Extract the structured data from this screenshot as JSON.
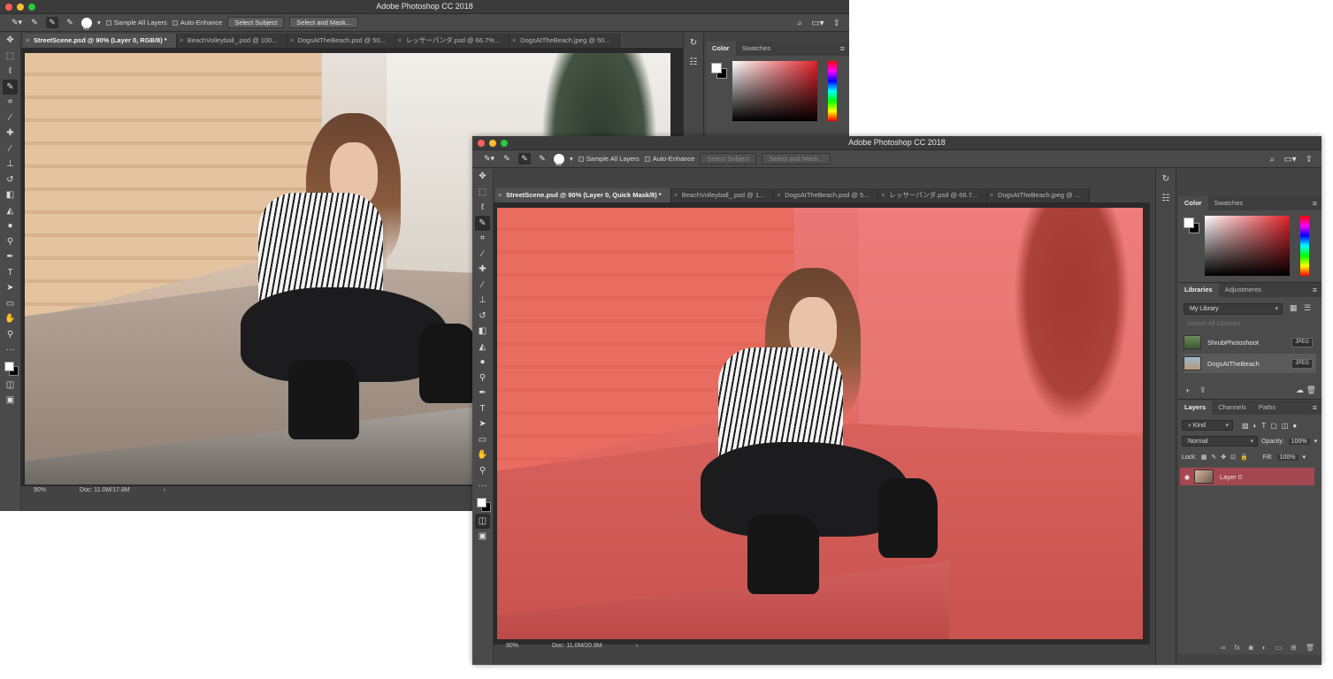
{
  "back_window": {
    "title": "Adobe Photoshop CC 2018",
    "options": {
      "brush_size": "45",
      "sample_all_layers": "Sample All Layers",
      "auto_enhance": "Auto-Enhance",
      "select_subject": "Select Subject",
      "select_and_mask": "Select and Mask..."
    },
    "tabs": [
      "StreetScene.psd @ 90% (Layer 0, RGB/8) *",
      "BeachVolleyball_.psd @ 100...",
      "DogsAtTheBeach.psd @ 50...",
      "レッサーパンダ.psd @ 66.7%...",
      "DogsAtTheBeach.jpeg @ 50..."
    ],
    "status": {
      "zoom": "90%",
      "doc": "Doc: 11.0M/17.8M",
      "arrow": "›"
    },
    "color_panel": {
      "tabs": [
        "Color",
        "Swatches"
      ]
    }
  },
  "front_window": {
    "title": "Adobe Photoshop CC 2018",
    "options": {
      "brush_size": "45",
      "sample_all_layers": "Sample All Layers",
      "auto_enhance": "Auto-Enhance",
      "select_subject": "Select Subject",
      "select_and_mask": "Select and Mask..."
    },
    "tabs": [
      "StreetScene.psd @ 90% (Layer 0, Quick Mask/8) *",
      "BeachVolleyball_.psd @ 1...",
      "DogsAtTheBeach.psd @ 5...",
      "レッサーパンダ.psd @ 66.7...",
      "DogsAtTheBeach.jpeg @ ..."
    ],
    "status": {
      "zoom": "90%",
      "doc": "Doc: 11.0M/20.9M",
      "arrow": "›"
    },
    "color_panel": {
      "tabs": [
        "Color",
        "Swatches"
      ]
    },
    "libraries_panel": {
      "tabs": [
        "Libraries",
        "Adjustments"
      ],
      "library": "My Library",
      "search_placeholder": "Search All Libraries",
      "items": [
        {
          "name": "ShrubPhotoshoot",
          "badge": "JPEG"
        },
        {
          "name": "DogsAtTheBeach",
          "badge": "JPEG"
        }
      ]
    },
    "layers_panel": {
      "tabs": [
        "Layers",
        "Channels",
        "Paths"
      ],
      "filter": "Kind",
      "blend_mode": "Normal",
      "opacity_label": "Opacity:",
      "opacity": "100%",
      "lock_label": "Lock:",
      "fill_label": "Fill:",
      "fill": "100%",
      "layers": [
        {
          "name": "Layer 0"
        }
      ]
    }
  },
  "colors": {
    "mask_red": "#eb3737",
    "layer_selected": "#a54750",
    "ui_bg": "#434343"
  }
}
